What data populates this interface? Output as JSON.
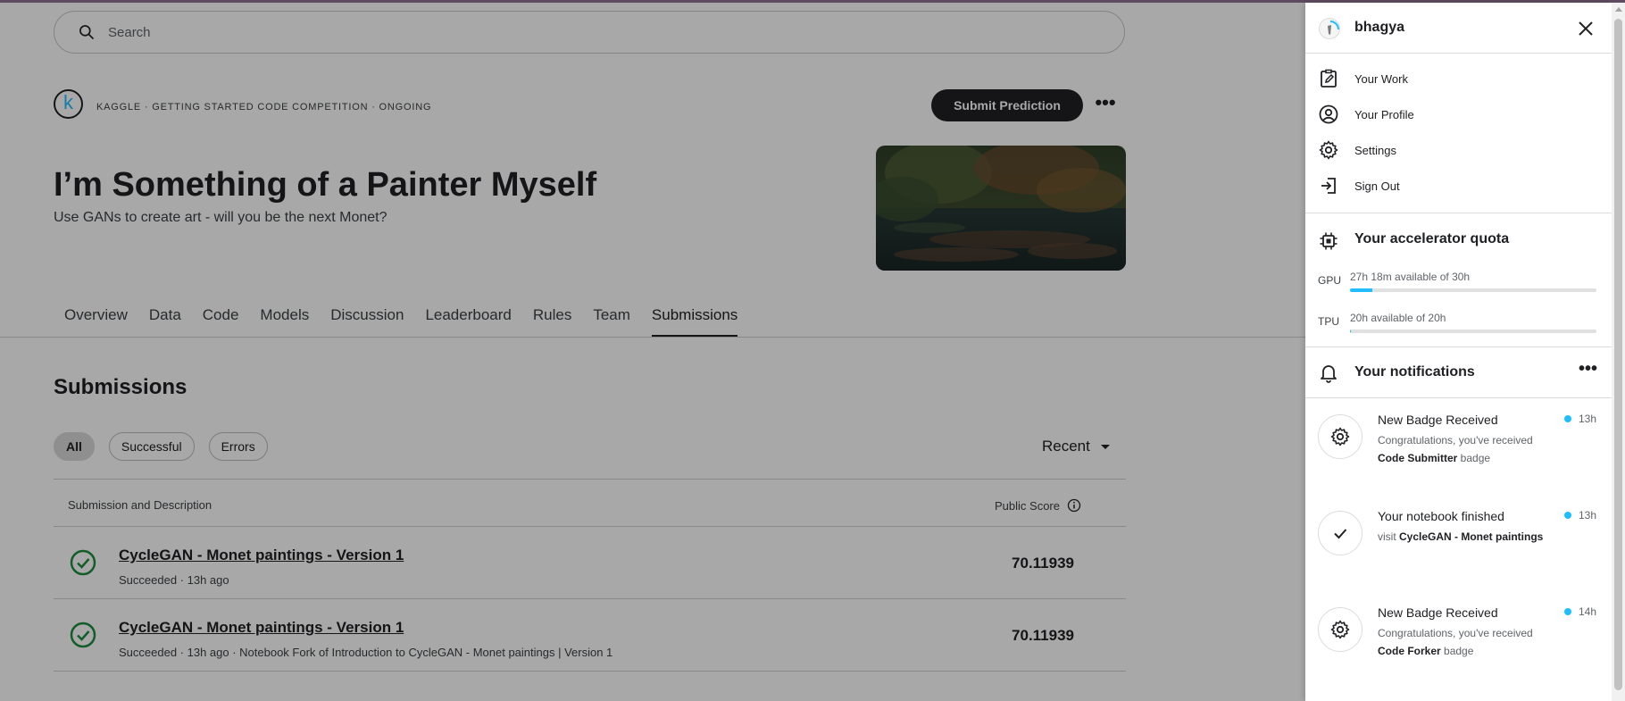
{
  "search": {
    "placeholder": "Search"
  },
  "competition": {
    "breadcrumb": "KAGGLE · GETTING STARTED CODE COMPETITION · ONGOING",
    "logo_letter": "k",
    "submit_label": "Submit Prediction",
    "title": "I’m Something of a Painter Myself",
    "subtitle": "Use GANs to create art - will you be the next Monet?"
  },
  "tabs": [
    {
      "label": "Overview"
    },
    {
      "label": "Data"
    },
    {
      "label": "Code"
    },
    {
      "label": "Models"
    },
    {
      "label": "Discussion"
    },
    {
      "label": "Leaderboard"
    },
    {
      "label": "Rules"
    },
    {
      "label": "Team"
    },
    {
      "label": "Submissions",
      "active": true
    }
  ],
  "submissions": {
    "title": "Submissions",
    "filters": [
      "All",
      "Successful",
      "Errors"
    ],
    "sort": "Recent",
    "columns": {
      "description": "Submission and Description",
      "score": "Public Score"
    },
    "rows": [
      {
        "name": "CycleGAN - Monet paintings - Version 1",
        "meta": "Succeeded · 13h ago",
        "score": "70.11939"
      },
      {
        "name": "CycleGAN - Monet paintings - Version 1",
        "meta": "Succeeded · 13h ago · Notebook Fork of Introduction to CycleGAN - Monet paintings | Version 1",
        "score": "70.11939"
      }
    ]
  },
  "panel": {
    "username": "bhagya",
    "menu": [
      {
        "label": "Your Work",
        "icon": "clipboard-edit-icon"
      },
      {
        "label": "Your Profile",
        "icon": "profile-icon"
      },
      {
        "label": "Settings",
        "icon": "gear-icon"
      },
      {
        "label": "Sign Out",
        "icon": "sign-out-icon"
      }
    ],
    "quota": {
      "title": "Your accelerator quota",
      "gpu": {
        "label": "GPU",
        "text": "27h 18m available of 30h",
        "used_fraction": 0.09
      },
      "tpu": {
        "label": "TPU",
        "text": "20h available of 20h",
        "used_fraction": 0.005
      }
    },
    "notifications": {
      "title": "Your notifications",
      "items": [
        {
          "title": "New Badge Received",
          "pre": "Congratulations, you've received ",
          "bold": "Code Submitter",
          "post": " badge",
          "time": "13h",
          "icon": "badge-gear-icon"
        },
        {
          "title": "Your notebook finished",
          "pre": "visit ",
          "bold": "CycleGAN - Monet paintings",
          "post": "",
          "time": "13h",
          "icon": "check-icon"
        },
        {
          "title": "New Badge Received",
          "pre": "Congratulations, you've received ",
          "bold": "Code Forker",
          "post": " badge",
          "time": "14h",
          "icon": "badge-gear-icon"
        }
      ]
    }
  },
  "colors": {
    "accent": "#20beff",
    "success": "#1e8e3e",
    "dark": "#202124"
  }
}
